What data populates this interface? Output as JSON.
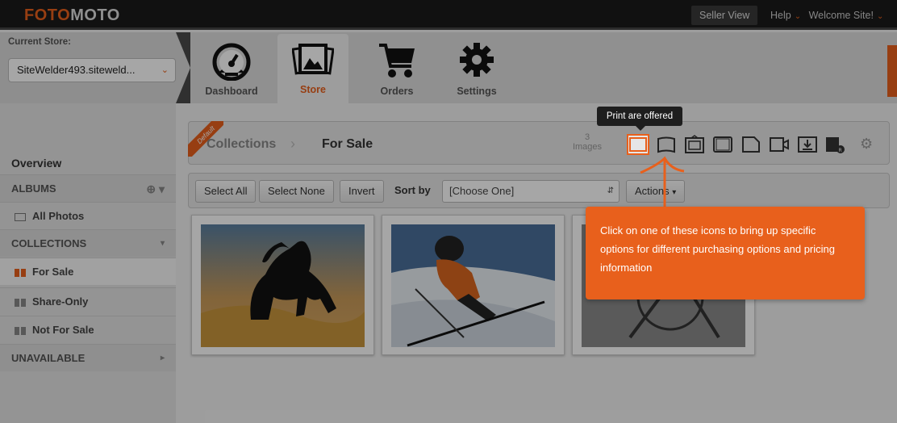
{
  "topbar": {
    "logo_part1": "FOTO",
    "logo_part2": "MOTO",
    "seller_view": "Seller View",
    "help": "Help",
    "welcome": "Welcome Site!"
  },
  "store": {
    "label": "Current Store:",
    "selected": "SiteWelder493.siteweld..."
  },
  "tabs": [
    {
      "label": "Dashboard",
      "icon": "dashboard-gauge-icon"
    },
    {
      "label": "Store",
      "icon": "photos-icon"
    },
    {
      "label": "Orders",
      "icon": "shopping-cart-icon"
    },
    {
      "label": "Settings",
      "icon": "gear-icon"
    }
  ],
  "sidebar": {
    "overview": "Overview",
    "albums": "ALBUMS",
    "all_photos": "All Photos",
    "collections": "COLLECTIONS",
    "items": [
      "For Sale",
      "Share-Only",
      "Not For Sale"
    ],
    "unavailable": "UNAVAILABLE"
  },
  "collection": {
    "ribbon": "Default",
    "crumb_root": "Collections",
    "crumb_current": "For Sale",
    "image_count": "3",
    "image_count_label": "Images"
  },
  "tooltip": "Print are offered",
  "toolbar": {
    "select_all": "Select All",
    "select_none": "Select None",
    "invert": "Invert",
    "sort_by": "Sort by",
    "sort_value": "[Choose One]",
    "actions": "Actions"
  },
  "callout": "Click on one of these icons to bring up specific options for different purchasing options and pricing information",
  "colors": {
    "accent": "#e8601c",
    "topbar": "#1b1b1b"
  },
  "product_icons": [
    "print-icon",
    "canvas-icon",
    "framed-print-icon",
    "poster-icon",
    "card-icon",
    "video-icon",
    "download-icon",
    "image-licensing-icon"
  ]
}
